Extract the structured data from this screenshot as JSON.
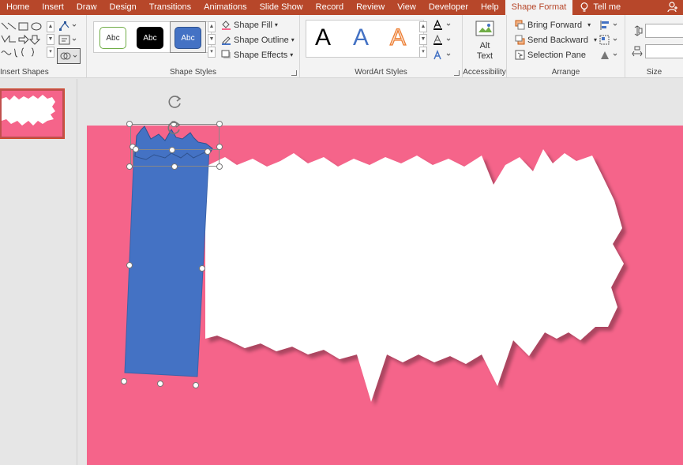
{
  "tabs": [
    {
      "label": "Home",
      "active": false
    },
    {
      "label": "Insert",
      "active": false
    },
    {
      "label": "Draw",
      "active": false
    },
    {
      "label": "Design",
      "active": false
    },
    {
      "label": "Transitions",
      "active": false
    },
    {
      "label": "Animations",
      "active": false
    },
    {
      "label": "Slide Show",
      "active": false
    },
    {
      "label": "Record",
      "active": false
    },
    {
      "label": "Review",
      "active": false
    },
    {
      "label": "View",
      "active": false
    },
    {
      "label": "Developer",
      "active": false
    },
    {
      "label": "Help",
      "active": false
    },
    {
      "label": "Shape Format",
      "active": true
    }
  ],
  "tell_me": "Tell me",
  "ribbon": {
    "insert_shapes_label": "Insert Shapes",
    "shape_styles_label": "Shape Styles",
    "wordart_styles_label": "WordArt Styles",
    "accessibility_label": "Accessibility",
    "arrange_label": "Arrange",
    "size_label": "Size",
    "style_samples": [
      "Abc",
      "Abc",
      "Abc"
    ],
    "shape_fill": "Shape Fill",
    "shape_outline": "Shape Outline",
    "shape_effects": "Shape Effects",
    "wordart_letters": [
      "A",
      "A",
      "A"
    ],
    "alt_text_line1": "Alt",
    "alt_text_line2": "Text",
    "bring_forward": "Bring Forward",
    "send_backward": "Send Backward",
    "selection_pane": "Selection Pane"
  },
  "colors": {
    "accent": "#b7472a",
    "slide_bg": "#f5648a",
    "shape_blue": "#4472c4"
  }
}
